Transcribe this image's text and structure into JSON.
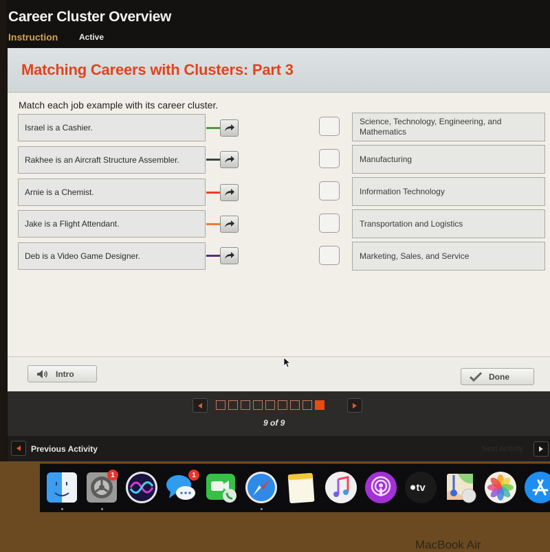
{
  "app": {
    "title": "Career Cluster Overview",
    "tabs": [
      {
        "label": "Instruction",
        "color": "#d2a24c"
      },
      {
        "label": "Active",
        "color": "#eaeaea"
      }
    ]
  },
  "activity": {
    "title": "Matching Careers with Clusters: Part 3",
    "title_color": "#e2431e",
    "instruction": "Match each job example with its career cluster.",
    "jobs": [
      {
        "text": "Israel is a Cashier.",
        "connector_color": "#4f9a3d"
      },
      {
        "text": "Rakhee is an Aircraft Structure Assembler.",
        "connector_color": "#2f4a44"
      },
      {
        "text": "Arnie is a Chemist.",
        "connector_color": "#e63e2e"
      },
      {
        "text": "Jake is a Flight Attendant.",
        "connector_color": "#f07a36"
      },
      {
        "text": "Deb is a Video Game Designer.",
        "connector_color": "#5a2a86"
      }
    ],
    "clusters": [
      {
        "text": "Science, Technology, Engineering, and Mathematics",
        "checked": false
      },
      {
        "text": "Manufacturing",
        "checked": false
      },
      {
        "text": "Information Technology",
        "checked": false
      },
      {
        "text": "Transportation and Logistics",
        "checked": false
      },
      {
        "text": "Marketing, Sales, and Service",
        "checked": false
      }
    ],
    "intro_button": "Intro",
    "done_button": "Done"
  },
  "pagination": {
    "current": 9,
    "total": 9,
    "label": "9 of 9",
    "accent": "#ec4a12"
  },
  "activity_nav": {
    "previous": "Previous Activity",
    "next": "Next Activity"
  },
  "dock": {
    "apps": [
      {
        "name": "Finder",
        "icon": "finder-icon",
        "running": true,
        "badge": null
      },
      {
        "name": "System Preferences",
        "icon": "system-preferences-icon",
        "running": true,
        "badge": "1"
      },
      {
        "name": "Siri",
        "icon": "siri-icon",
        "running": false,
        "badge": null
      },
      {
        "name": "Messages",
        "icon": "messages-icon",
        "running": false,
        "badge": "1"
      },
      {
        "name": "FaceTime",
        "icon": "facetime-icon",
        "running": false,
        "badge": null
      },
      {
        "name": "Safari",
        "icon": "safari-icon",
        "running": true,
        "badge": null
      },
      {
        "name": "Notes",
        "icon": "notes-icon",
        "running": false,
        "badge": null
      },
      {
        "name": "Music",
        "icon": "music-icon",
        "running": false,
        "badge": null
      },
      {
        "name": "Podcasts",
        "icon": "podcasts-icon",
        "running": false,
        "badge": null
      },
      {
        "name": "TV",
        "icon": "apple-tv-icon",
        "running": false,
        "badge": null,
        "label": "tv"
      },
      {
        "name": "Maps",
        "icon": "maps-icon",
        "running": false,
        "badge": null
      },
      {
        "name": "Photos",
        "icon": "photos-icon",
        "running": false,
        "badge": null
      },
      {
        "name": "App Store",
        "icon": "app-store-icon",
        "running": false,
        "badge": null
      }
    ]
  },
  "device_label": "MacBook Air"
}
